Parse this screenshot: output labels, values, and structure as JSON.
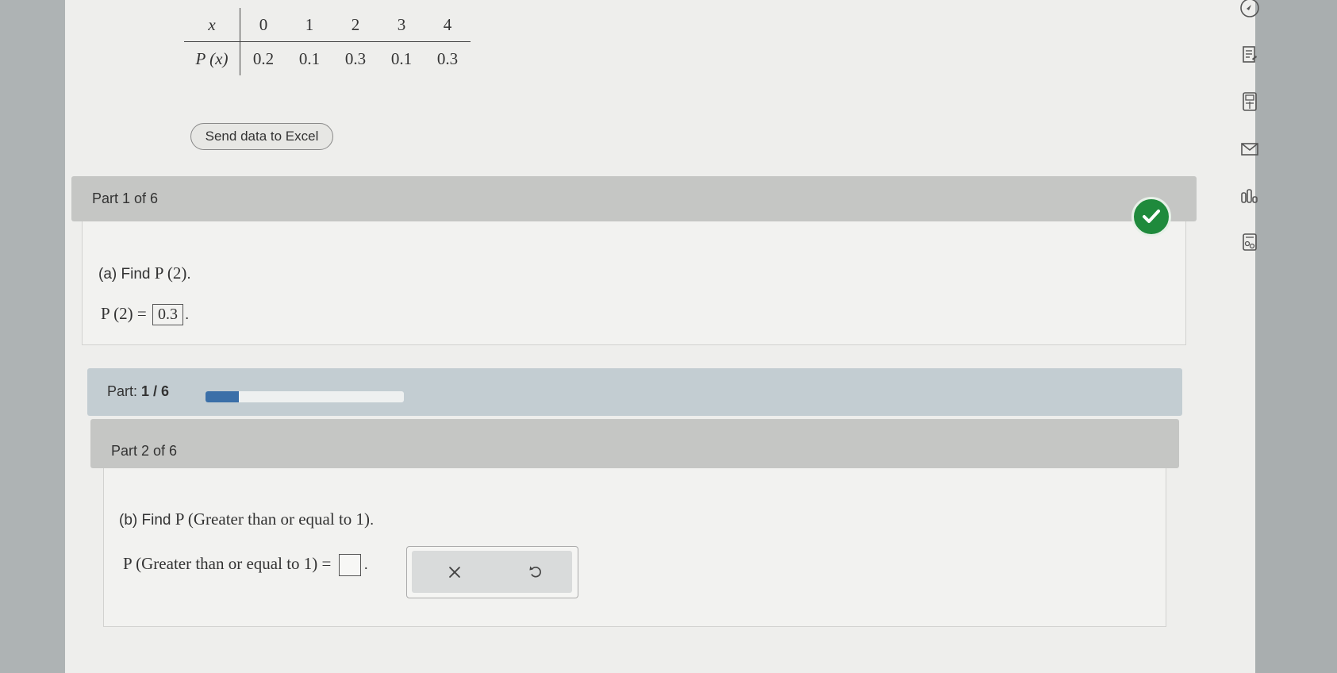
{
  "table": {
    "header_label": "x",
    "row_label": "P (x)",
    "x_values": [
      "0",
      "1",
      "2",
      "3",
      "4"
    ],
    "p_values": [
      "0.2",
      "0.1",
      "0.3",
      "0.1",
      "0.3"
    ]
  },
  "send_excel_label": "Send data to Excel",
  "part1": {
    "title": "Part 1 of 6",
    "question_prefix": "(a) Find ",
    "question_math": "P (2)",
    "question_suffix": ".",
    "answer_lhs": "P (2) =",
    "answer_value": "0.3",
    "answer_suffix": "."
  },
  "progress": {
    "label": "Part:",
    "count": "1 / 6",
    "fraction": 0.1667,
    "fill_color": "#3b6fa8"
  },
  "part2": {
    "title": "Part 2 of 6",
    "question_prefix": "(b) Find ",
    "question_math": "P (Greater than or equal to 1)",
    "question_suffix": ".",
    "answer_lhs": "P (Greater than or equal to 1) =",
    "answer_suffix": "."
  },
  "icons": [
    "compass-icon",
    "notes-icon",
    "calculator-icon",
    "mail-icon",
    "stats-icon",
    "report-icon"
  ],
  "colors": {
    "check_green": "#1f8a3c",
    "accent_blue": "#3b6fa8"
  }
}
